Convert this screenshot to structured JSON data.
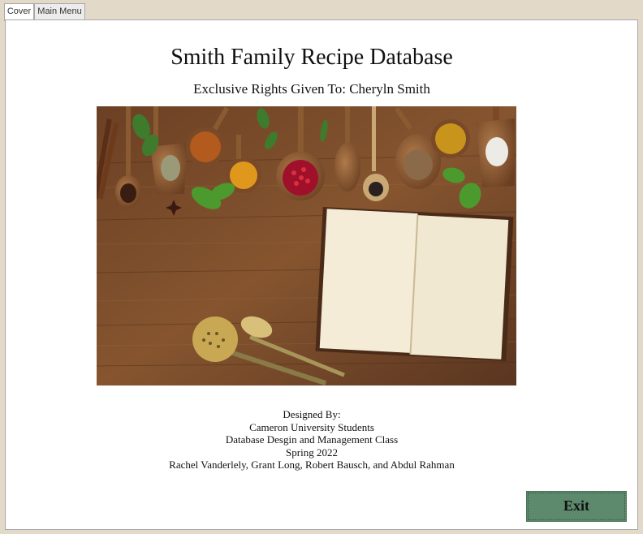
{
  "tabs": [
    {
      "label": "Cover",
      "active": true
    },
    {
      "label": "Main Menu",
      "active": false
    }
  ],
  "cover": {
    "title": "Smith Family Recipe Database",
    "subtitle": "Exclusive Rights Given To: Cheryln Smith",
    "credits": [
      "Designed By:",
      "Cameron University Students",
      "Database Desgin and Management Class",
      "Spring 2022",
      "Rachel Vanderlely, Grant Long, Robert Bausch, and Abdul Rahman"
    ],
    "exit_label": "Exit"
  },
  "colors": {
    "exit_button": "#5d8a6c",
    "window_background": "#e3d9c9"
  }
}
